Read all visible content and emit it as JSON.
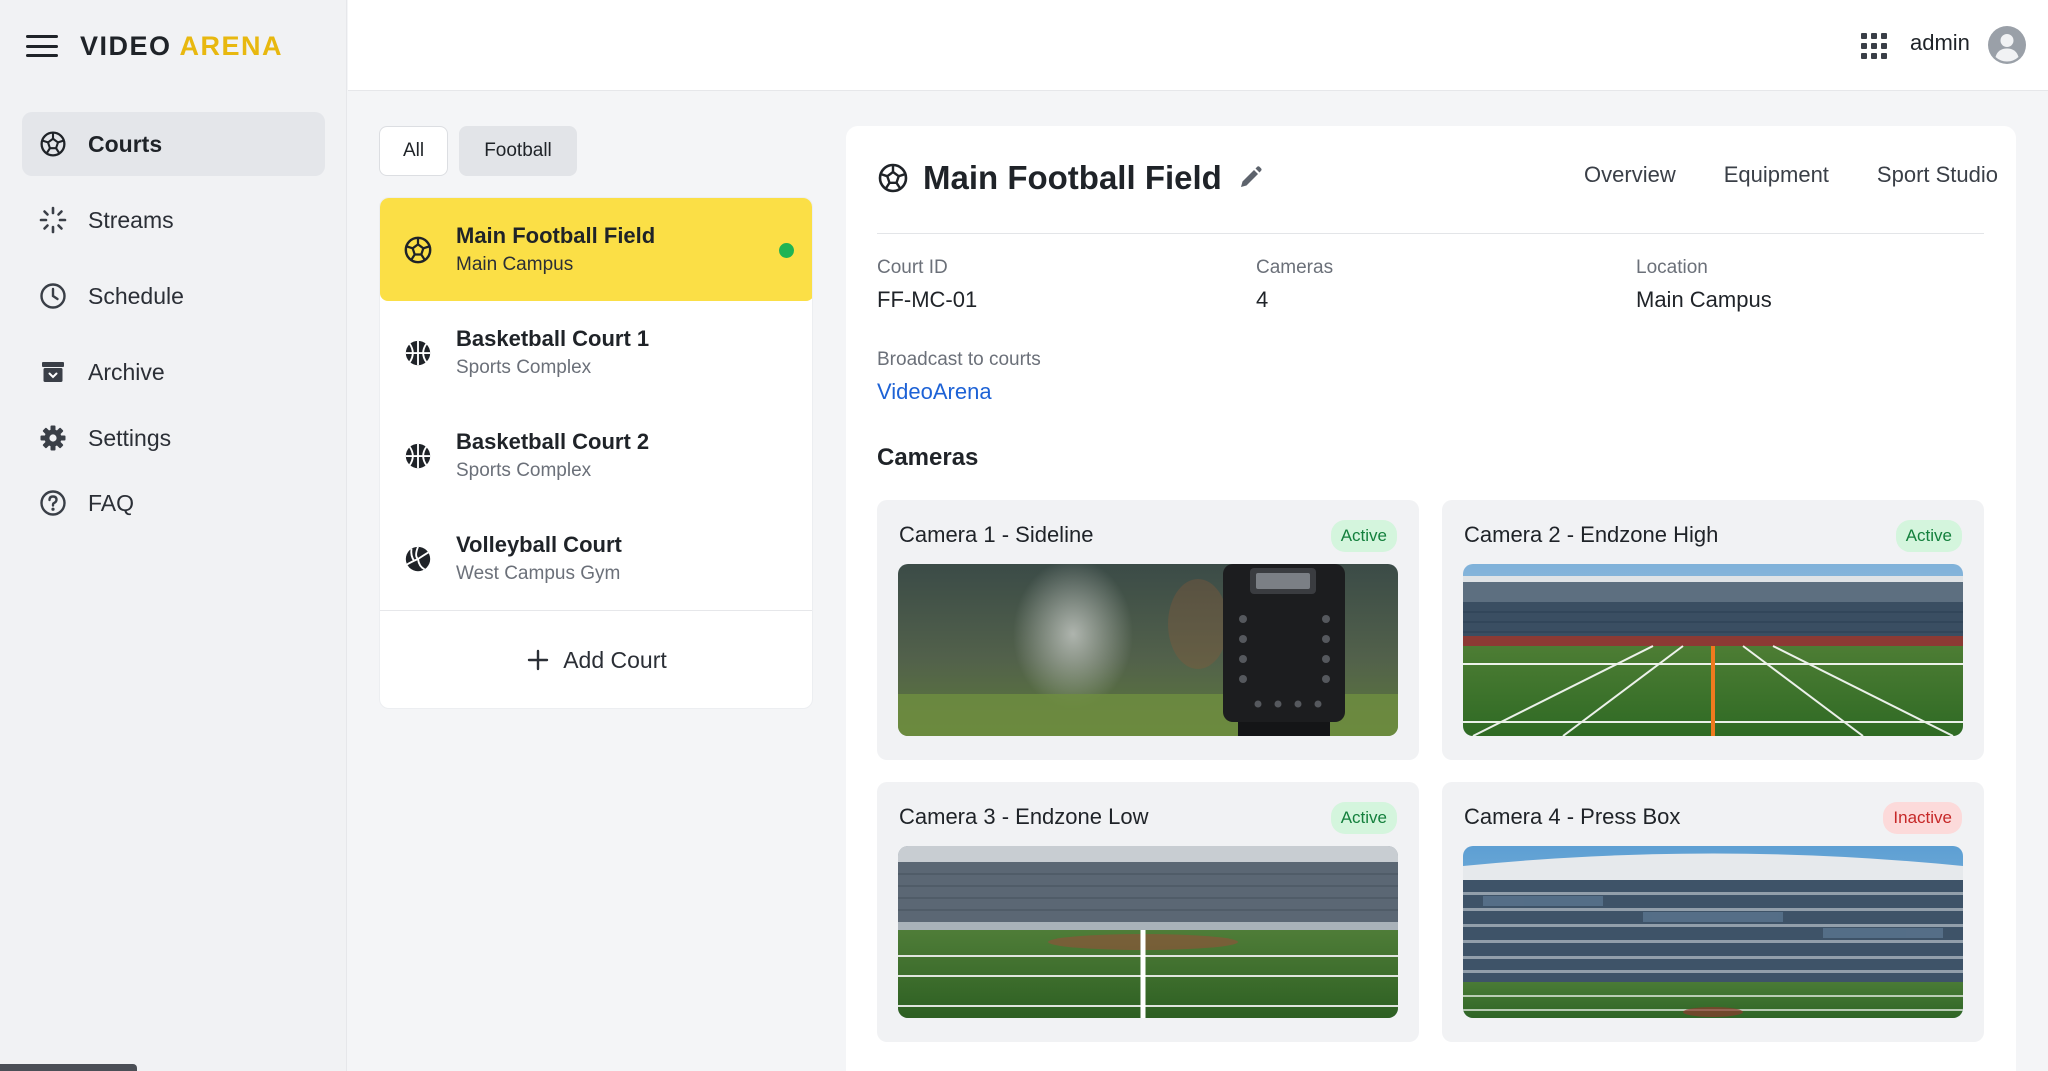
{
  "app": {
    "logo_word1": "VIDEO",
    "logo_word2": "ARENA",
    "accent_color": "#FBDF46"
  },
  "sidebar": {
    "items": [
      {
        "label": "Courts",
        "icon": "football-icon",
        "active": true
      },
      {
        "label": "Streams",
        "icon": "streams-icon",
        "active": false
      },
      {
        "label": "Schedule",
        "icon": "clock-icon",
        "active": false
      },
      {
        "label": "Archive",
        "icon": "archive-icon",
        "active": false
      },
      {
        "label": "Settings",
        "icon": "gear-icon",
        "active": false
      },
      {
        "label": "FAQ",
        "icon": "help-icon",
        "active": false
      }
    ]
  },
  "header": {
    "user_name": "admin"
  },
  "filters": {
    "all": "All",
    "football": "Football",
    "selected": "Football"
  },
  "courts": [
    {
      "name": "Main Football Field",
      "location": "Main Campus",
      "sport_icon": "football-icon",
      "selected": true,
      "online": true
    },
    {
      "name": "Basketball Court 1",
      "location": "Sports Complex",
      "sport_icon": "basketball-icon",
      "selected": false
    },
    {
      "name": "Basketball Court 2",
      "location": "Sports Complex",
      "sport_icon": "basketball-icon",
      "selected": false
    },
    {
      "name": "Volleyball Court",
      "location": "West Campus Gym",
      "sport_icon": "volleyball-icon",
      "selected": false
    }
  ],
  "add_court_label": "Add Court",
  "detail": {
    "title": "Main Football Field",
    "tabs": [
      "Overview",
      "Equipment",
      "Sport Studio"
    ],
    "court_id_label": "Court ID",
    "court_id": "FF-MC-01",
    "cameras_label": "Cameras",
    "cameras_count": "4",
    "location_label": "Location",
    "location": "Main Campus",
    "broadcast_label": "Broadcast to courts",
    "broadcast_value": "VideoArena",
    "cameras_section_title": "Cameras",
    "cameras": [
      {
        "name": "Camera 1 - Sideline",
        "status": "Active"
      },
      {
        "name": "Camera 2 - Endzone High",
        "status": "Active"
      },
      {
        "name": "Camera 3 - Endzone Low",
        "status": "Active"
      },
      {
        "name": "Camera 4 - Press Box",
        "status": "Inactive"
      }
    ]
  }
}
